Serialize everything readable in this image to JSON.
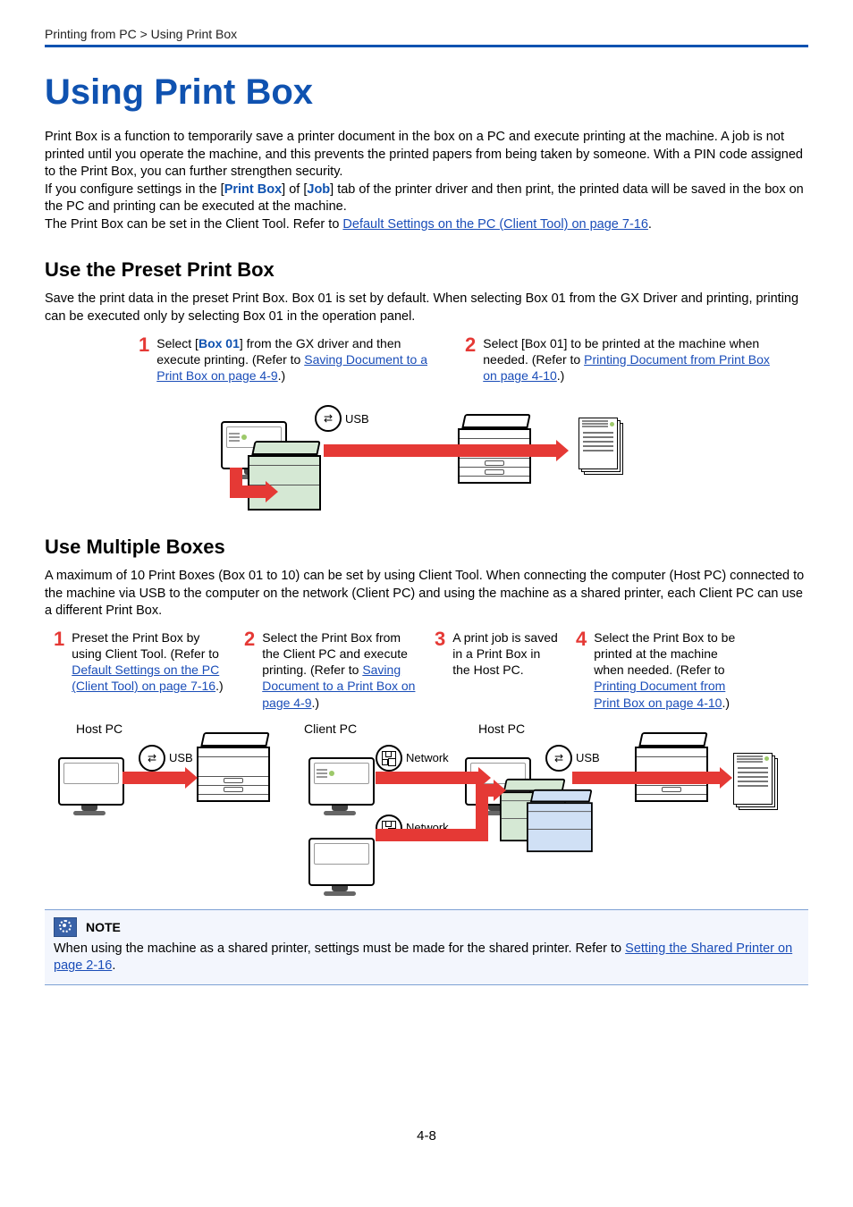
{
  "breadcrumb": "Printing from PC > Using Print Box",
  "title": "Using Print Box",
  "intro": {
    "p1": "Print Box is a function to temporarily save a printer document in the box on a PC and execute printing at the machine. A job is not printed until you operate the machine, and this prevents the printed papers from being taken by someone. With a PIN code assigned to the Print Box, you can further strengthen security.",
    "p2_a": "If you configure settings in the [",
    "p2_bold1": "Print Box",
    "p2_b": "] of [",
    "p2_bold2": "Job",
    "p2_c": "] tab of the printer driver and then print, the printed data will be saved in the box on the PC and printing can be executed at the machine.",
    "p3_a": "The Print Box can be set in the Client Tool. Refer to ",
    "p3_link": "Default Settings on the PC (Client Tool) on page 7-16",
    "p3_b": "."
  },
  "preset": {
    "heading": "Use the Preset Print Box",
    "desc": "Save the print data in the preset Print Box. Box 01 is set by default. When selecting Box 01 from the GX Driver and printing, printing can be executed only by selecting Box 01 in the operation panel.",
    "steps": [
      {
        "num": "1",
        "a": "Select [",
        "bold": "Box 01",
        "b": "] from the GX driver and then execute printing. (Refer to ",
        "link": "Saving Document to a Print Box on page 4-9",
        "c": ".)"
      },
      {
        "num": "2",
        "a": "Select [Box 01] to be printed at the machine when needed. (Refer to ",
        "link": "Printing Document from Print Box on page 4-10",
        "c": ".)"
      }
    ],
    "diagram": {
      "usb": "USB"
    }
  },
  "multiple": {
    "heading": "Use Multiple Boxes",
    "desc": "A maximum of 10 Print Boxes (Box 01 to 10) can be set by using Client Tool. When connecting the computer (Host PC) connected to the machine via USB to the computer on the network (Client PC) and using the machine as a shared printer, each Client PC can use a different Print Box.",
    "steps": [
      {
        "num": "1",
        "a": "Preset the Print Box by using Client Tool. (Refer to ",
        "link": "Default Settings on the PC (Client Tool) on page 7-16",
        "c": ".)"
      },
      {
        "num": "2",
        "a": "Select the Print Box from the Client PC and execute printing. (Refer to ",
        "link": "Saving Document to a Print Box on page 4-9",
        "c": ".)"
      },
      {
        "num": "3",
        "a": "A print job is saved in a Print Box in the Host PC."
      },
      {
        "num": "4",
        "a": "Select the Print Box to be printed at the machine when needed. (Refer to ",
        "link": "Printing Document from Print Box on page 4-10",
        "c": ".)"
      }
    ],
    "diagram": {
      "host_pc": "Host PC",
      "client_pc": "Client PC",
      "usb": "USB",
      "network": "Network"
    }
  },
  "note": {
    "label": "NOTE",
    "a": "When using the machine as a shared printer, settings must be made for the shared printer. Refer to ",
    "link": "Setting the Shared Printer on page 2-16",
    "c": "."
  },
  "page_number": "4-8"
}
